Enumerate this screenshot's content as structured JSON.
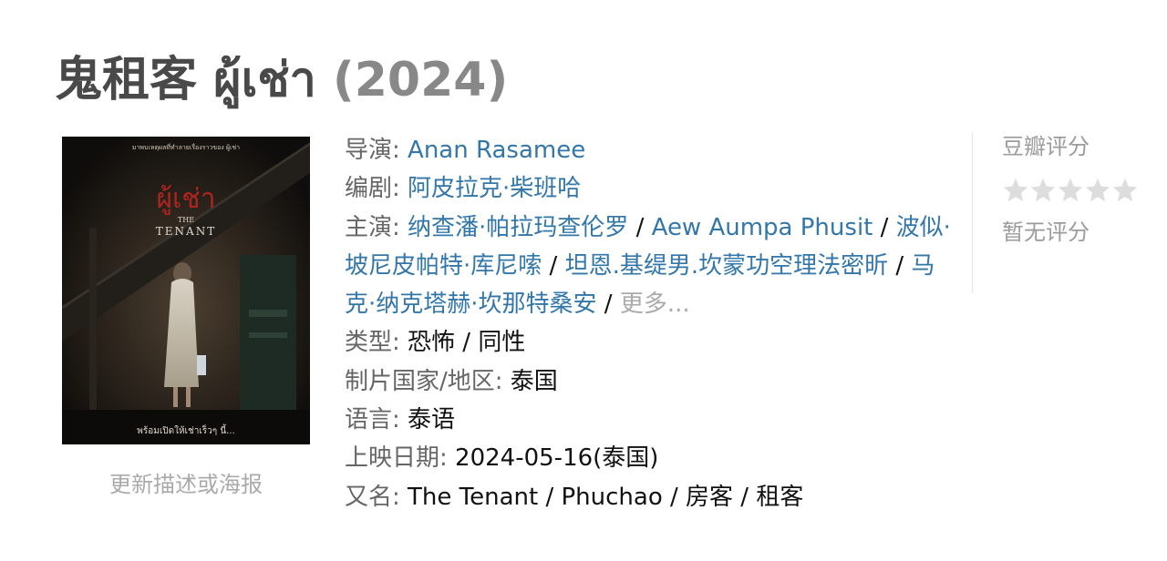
{
  "title": {
    "name": "鬼租客 ผู้เช่า",
    "year": "(2024)"
  },
  "poster": {
    "top_caption": "มาพบเหตุผลที่ทำลายเรื่องราวของ ผู้เช่า",
    "title_thai": "ผู้เช่า",
    "title_the": "THE",
    "title_en": "TENANT",
    "bottom_caption": "พร้อมเปิดให้เช่าเร็วๆ นี้...",
    "update_link": "更新描述或海报"
  },
  "info": {
    "director_label": "导演",
    "director": "Anan Rasamee",
    "writer_label": "编剧",
    "writer": "阿皮拉克·柴班哈",
    "cast_label": "主演",
    "cast": [
      "纳查潘·帕拉玛查伦罗",
      "Aew Aumpa Phusit",
      "波似·坡尼皮帕特·库尼嗦",
      "坦恩.基缇男.坎蒙功空理法密昕",
      "马克·纳克塔赫·坎那特桑安"
    ],
    "cast_more": "更多...",
    "genre_label": "类型",
    "genre": "恐怖 / 同性",
    "country_label": "制片国家/地区",
    "country": "泰国",
    "language_label": "语言",
    "language": "泰语",
    "release_label": "上映日期",
    "release": "2024-05-16(泰国)",
    "aka_label": "又名",
    "aka": "The Tenant / Phuchao / 房客 / 租客"
  },
  "rating": {
    "title": "豆瓣评分",
    "stars": 0,
    "no_rating": "暂无评分",
    "star_color": "#dddddd"
  }
}
